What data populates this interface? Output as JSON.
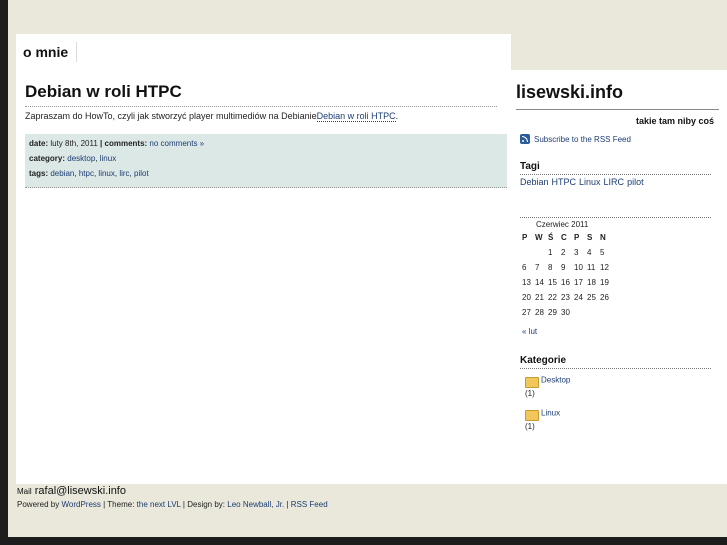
{
  "nav": {
    "menu_item": "o mnie"
  },
  "post": {
    "title": "Debian w roli HTPC",
    "body_text": "Zapraszam do HowTo, czyli jak stworzyć player multimediów na Debianie",
    "body_link": "Debian w roli HTPC",
    "body_end": ".",
    "meta": {
      "date_label": "date:",
      "date_value": "luty 8th, 2011",
      "comments_label": "| comments:",
      "comments_link": "no comments »",
      "category_label": "category:",
      "categories": [
        "desktop",
        "linux"
      ],
      "tags_label": "tags:",
      "tags": [
        "debian",
        "htpc",
        "linux",
        "lirc",
        "pilot"
      ]
    }
  },
  "sidebar": {
    "site_title": "lisewski.info",
    "tagline": "takie tam niby coś",
    "rss_label": "Subscribe to the RSS Feed",
    "tags_title": "Tagi",
    "tags": [
      "Debian",
      "HTPC",
      "Linux",
      "LIRC",
      "pilot"
    ],
    "calendar": {
      "caption": "Czerwiec 2011",
      "weekdays": [
        "P",
        "W",
        "Ś",
        "C",
        "P",
        "S",
        "N"
      ],
      "weeks": [
        [
          "",
          "",
          "1",
          "2",
          "3",
          "4",
          "5"
        ],
        [
          "6",
          "7",
          "8",
          "9",
          "10",
          "11",
          "12"
        ],
        [
          "13",
          "14",
          "15",
          "16",
          "17",
          "18",
          "19"
        ],
        [
          "20",
          "21",
          "22",
          "23",
          "24",
          "25",
          "26"
        ],
        [
          "27",
          "28",
          "29",
          "30",
          "",
          "",
          ""
        ]
      ],
      "prev_link": "« lut"
    },
    "categories_title": "Kategorie",
    "categories": [
      {
        "name": "Desktop",
        "count": "(1)"
      },
      {
        "name": "Linux",
        "count": "(1)"
      }
    ]
  },
  "footer": {
    "mail_label": "Mail",
    "mail_value": "rafal@lisewski.info",
    "powered_prefix": "Powered by",
    "wordpress": "WordPress",
    "theme_prefix": "| Theme:",
    "theme_link": "the next LVL",
    "design_prefix": "| Design by:",
    "designer": "Leo Newball, Jr.",
    "separator": "|",
    "rss_feed": "RSS Feed"
  },
  "colors": {
    "link": "#1d3d73",
    "page_bg": "#e9e8da",
    "meta_bg": "#dce8e6",
    "outer_bg": "#1d1d1d"
  }
}
